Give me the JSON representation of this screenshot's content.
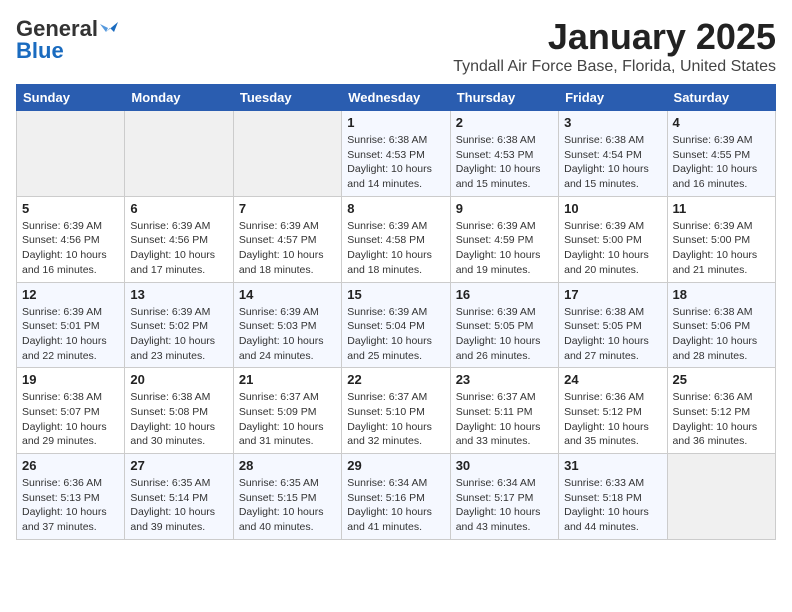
{
  "logo": {
    "line1": "General",
    "line2": "Blue"
  },
  "title": "January 2025",
  "subtitle": "Tyndall Air Force Base, Florida, United States",
  "weekdays": [
    "Sunday",
    "Monday",
    "Tuesday",
    "Wednesday",
    "Thursday",
    "Friday",
    "Saturday"
  ],
  "weeks": [
    [
      {
        "day": "",
        "info": ""
      },
      {
        "day": "",
        "info": ""
      },
      {
        "day": "",
        "info": ""
      },
      {
        "day": "1",
        "info": "Sunrise: 6:38 AM\nSunset: 4:53 PM\nDaylight: 10 hours\nand 14 minutes."
      },
      {
        "day": "2",
        "info": "Sunrise: 6:38 AM\nSunset: 4:53 PM\nDaylight: 10 hours\nand 15 minutes."
      },
      {
        "day": "3",
        "info": "Sunrise: 6:38 AM\nSunset: 4:54 PM\nDaylight: 10 hours\nand 15 minutes."
      },
      {
        "day": "4",
        "info": "Sunrise: 6:39 AM\nSunset: 4:55 PM\nDaylight: 10 hours\nand 16 minutes."
      }
    ],
    [
      {
        "day": "5",
        "info": "Sunrise: 6:39 AM\nSunset: 4:56 PM\nDaylight: 10 hours\nand 16 minutes."
      },
      {
        "day": "6",
        "info": "Sunrise: 6:39 AM\nSunset: 4:56 PM\nDaylight: 10 hours\nand 17 minutes."
      },
      {
        "day": "7",
        "info": "Sunrise: 6:39 AM\nSunset: 4:57 PM\nDaylight: 10 hours\nand 18 minutes."
      },
      {
        "day": "8",
        "info": "Sunrise: 6:39 AM\nSunset: 4:58 PM\nDaylight: 10 hours\nand 18 minutes."
      },
      {
        "day": "9",
        "info": "Sunrise: 6:39 AM\nSunset: 4:59 PM\nDaylight: 10 hours\nand 19 minutes."
      },
      {
        "day": "10",
        "info": "Sunrise: 6:39 AM\nSunset: 5:00 PM\nDaylight: 10 hours\nand 20 minutes."
      },
      {
        "day": "11",
        "info": "Sunrise: 6:39 AM\nSunset: 5:00 PM\nDaylight: 10 hours\nand 21 minutes."
      }
    ],
    [
      {
        "day": "12",
        "info": "Sunrise: 6:39 AM\nSunset: 5:01 PM\nDaylight: 10 hours\nand 22 minutes."
      },
      {
        "day": "13",
        "info": "Sunrise: 6:39 AM\nSunset: 5:02 PM\nDaylight: 10 hours\nand 23 minutes."
      },
      {
        "day": "14",
        "info": "Sunrise: 6:39 AM\nSunset: 5:03 PM\nDaylight: 10 hours\nand 24 minutes."
      },
      {
        "day": "15",
        "info": "Sunrise: 6:39 AM\nSunset: 5:04 PM\nDaylight: 10 hours\nand 25 minutes."
      },
      {
        "day": "16",
        "info": "Sunrise: 6:39 AM\nSunset: 5:05 PM\nDaylight: 10 hours\nand 26 minutes."
      },
      {
        "day": "17",
        "info": "Sunrise: 6:38 AM\nSunset: 5:05 PM\nDaylight: 10 hours\nand 27 minutes."
      },
      {
        "day": "18",
        "info": "Sunrise: 6:38 AM\nSunset: 5:06 PM\nDaylight: 10 hours\nand 28 minutes."
      }
    ],
    [
      {
        "day": "19",
        "info": "Sunrise: 6:38 AM\nSunset: 5:07 PM\nDaylight: 10 hours\nand 29 minutes."
      },
      {
        "day": "20",
        "info": "Sunrise: 6:38 AM\nSunset: 5:08 PM\nDaylight: 10 hours\nand 30 minutes."
      },
      {
        "day": "21",
        "info": "Sunrise: 6:37 AM\nSunset: 5:09 PM\nDaylight: 10 hours\nand 31 minutes."
      },
      {
        "day": "22",
        "info": "Sunrise: 6:37 AM\nSunset: 5:10 PM\nDaylight: 10 hours\nand 32 minutes."
      },
      {
        "day": "23",
        "info": "Sunrise: 6:37 AM\nSunset: 5:11 PM\nDaylight: 10 hours\nand 33 minutes."
      },
      {
        "day": "24",
        "info": "Sunrise: 6:36 AM\nSunset: 5:12 PM\nDaylight: 10 hours\nand 35 minutes."
      },
      {
        "day": "25",
        "info": "Sunrise: 6:36 AM\nSunset: 5:12 PM\nDaylight: 10 hours\nand 36 minutes."
      }
    ],
    [
      {
        "day": "26",
        "info": "Sunrise: 6:36 AM\nSunset: 5:13 PM\nDaylight: 10 hours\nand 37 minutes."
      },
      {
        "day": "27",
        "info": "Sunrise: 6:35 AM\nSunset: 5:14 PM\nDaylight: 10 hours\nand 39 minutes."
      },
      {
        "day": "28",
        "info": "Sunrise: 6:35 AM\nSunset: 5:15 PM\nDaylight: 10 hours\nand 40 minutes."
      },
      {
        "day": "29",
        "info": "Sunrise: 6:34 AM\nSunset: 5:16 PM\nDaylight: 10 hours\nand 41 minutes."
      },
      {
        "day": "30",
        "info": "Sunrise: 6:34 AM\nSunset: 5:17 PM\nDaylight: 10 hours\nand 43 minutes."
      },
      {
        "day": "31",
        "info": "Sunrise: 6:33 AM\nSunset: 5:18 PM\nDaylight: 10 hours\nand 44 minutes."
      },
      {
        "day": "",
        "info": ""
      }
    ]
  ]
}
